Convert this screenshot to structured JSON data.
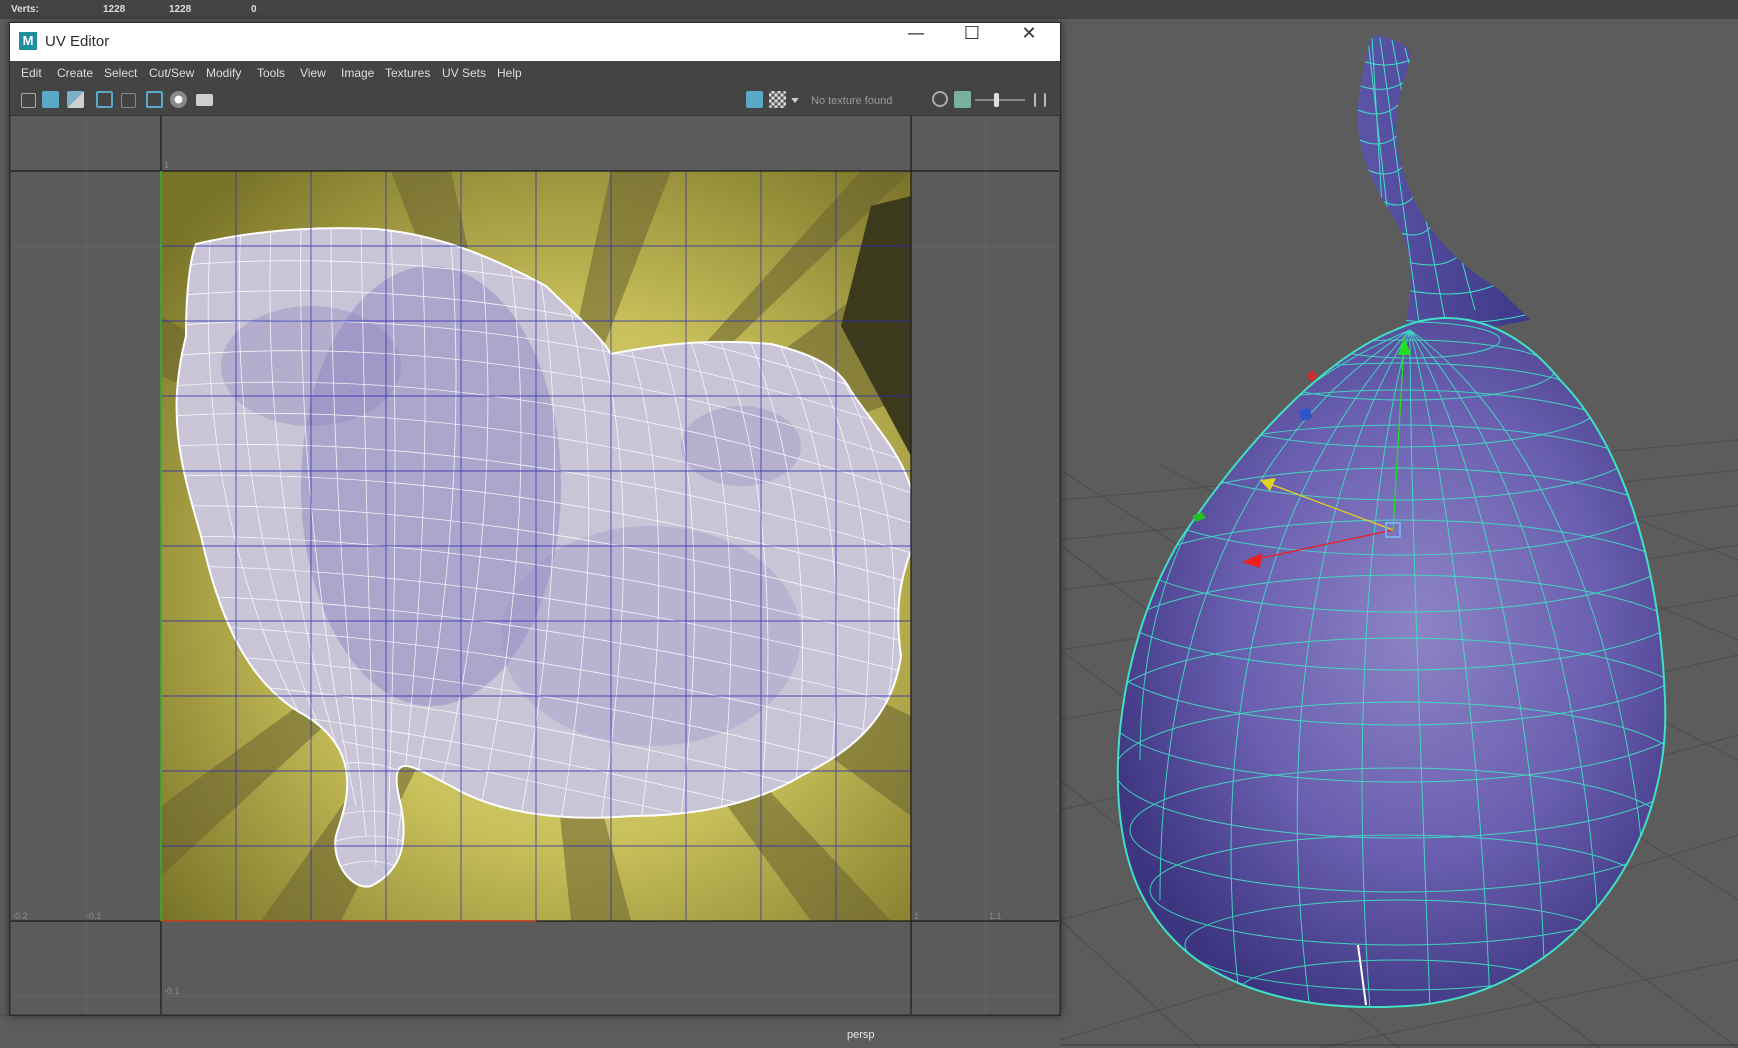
{
  "status_bar": {
    "verts_label": "Verts:",
    "values": [
      "1228",
      "1228",
      "0"
    ]
  },
  "uv_editor": {
    "title": "UV Editor",
    "logo": "M",
    "window_controls": {
      "minimize": "—",
      "maximize": "☐",
      "close": "✕"
    },
    "menu": [
      "Edit",
      "Create",
      "Select",
      "Cut/Sew",
      "Modify",
      "Tools",
      "View",
      "Image",
      "Textures",
      "UV Sets",
      "Help"
    ],
    "texture_field": "No texture found",
    "axis_labels": {
      "u_neg02": "-0.2",
      "u_neg01": "-0.1",
      "u_one": "1",
      "u_11": "1.1",
      "v_one": "1",
      "v_neg01": "-0.1"
    },
    "icons": [
      "uv-shell-icon",
      "texture-borders-icon",
      "distortion-icon",
      "grid-icon",
      "pixel-snap-icon",
      "checker-icon",
      "isolate-icon",
      "snapshot-icon",
      "image-display-icon",
      "checker-tiles-icon",
      "dropdown-arrow-icon",
      "exposure-icon",
      "gamma-icon",
      "slider-handle-icon",
      "expand-icon"
    ]
  },
  "viewport": {
    "camera_label": "persp"
  },
  "colors": {
    "panel": "#444444",
    "uv_wire": "#ffffff",
    "mesh_wire": "#3fe0c4",
    "fig_purple": "#6b5fae",
    "texture_yellow": "#c9c05a"
  }
}
